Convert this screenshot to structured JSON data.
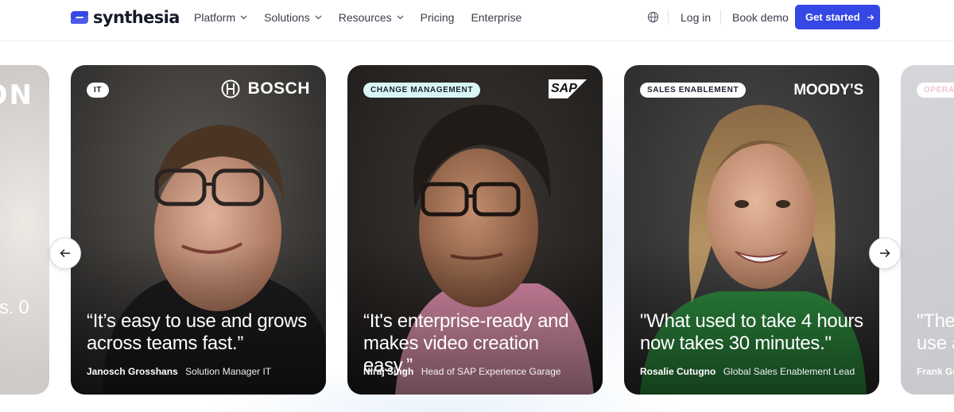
{
  "header": {
    "logo": "synthesia",
    "menu": [
      {
        "label": "Platform",
        "dropdown": true
      },
      {
        "label": "Solutions",
        "dropdown": true
      },
      {
        "label": "Resources",
        "dropdown": true
      },
      {
        "label": "Pricing",
        "dropdown": false
      },
      {
        "label": "Enterprise",
        "dropdown": false
      }
    ],
    "language_icon": "globe-icon",
    "login": "Log in",
    "book_demo": "Book demo",
    "get_started": "Get started",
    "accent_color": "#3547e5"
  },
  "carousel": {
    "prev_icon": "arrow-left-icon",
    "next_icon": "arrow-right-icon",
    "partial_left": {
      "logo_fragment": "ON",
      "quote_fragment": "s. 0"
    },
    "cards": [
      {
        "tag": "IT",
        "tag_color": "#ffffff",
        "company": "BOSCH",
        "quote_line1": "“It’s easy to use and grows",
        "quote_line2": "across teams fast.”",
        "name": "Janosch Grosshans",
        "role": "Solution Manager IT"
      },
      {
        "tag": "CHANGE MANAGEMENT",
        "tag_color": "#d7f6f5",
        "company": "SAP",
        "quote_line1": "“It's enterprise-ready and",
        "quote_line2": "makes video creation easy.”",
        "name": "Niraj Singh",
        "role": "Head of SAP Experience Garage"
      },
      {
        "tag": "SALES ENABLEMENT",
        "tag_color": "#ffffff",
        "company": "MOODY’S",
        "quote_line1": "\"What used to take 4 hours",
        "quote_line2": "now takes 30 minutes.\"",
        "name": "Rosalie Cutugno",
        "role": "Global Sales Enablement Lead"
      }
    ],
    "partial_right": {
      "tag_fragment": "OPERA",
      "quote_line1": "\"The",
      "quote_line2": "use a",
      "name_fragment": "Frank Gr"
    }
  }
}
